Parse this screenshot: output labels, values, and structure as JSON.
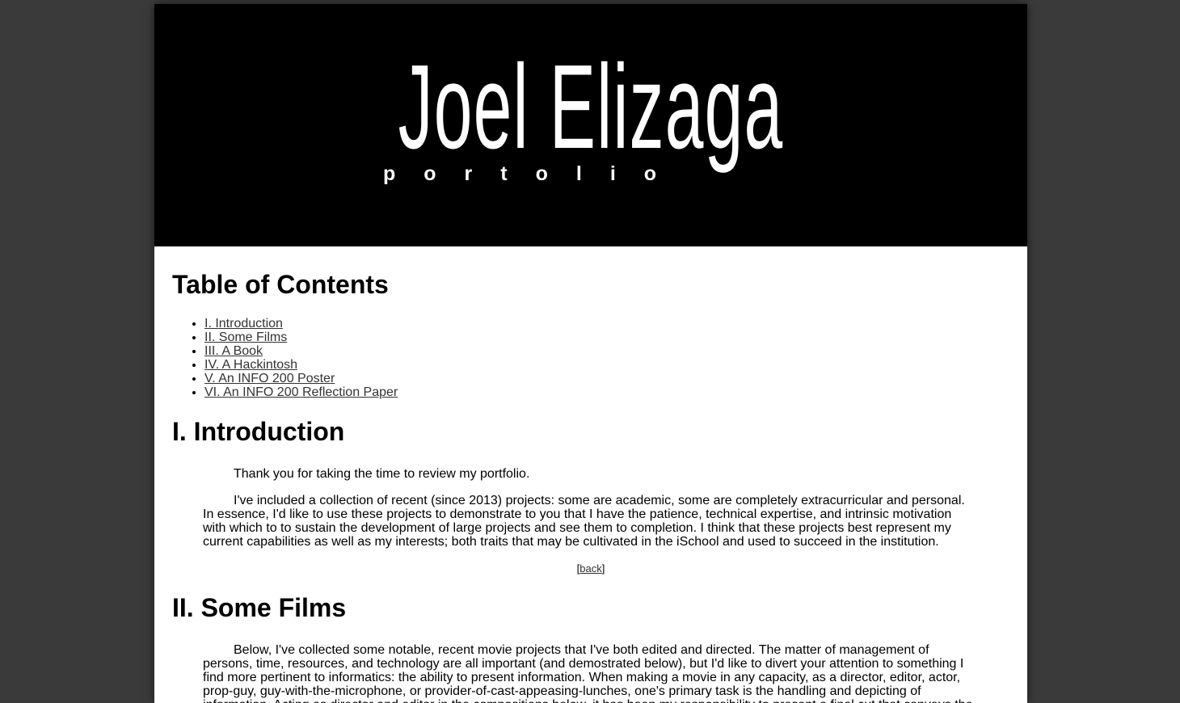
{
  "header": {
    "name": "Joel Elizaga",
    "subtitle": "portolio"
  },
  "toc": {
    "title": "Table of Contents",
    "items": [
      {
        "label": "I. Introduction"
      },
      {
        "label": "II. Some Films"
      },
      {
        "label": "III. A Book"
      },
      {
        "label": "IV. A Hackintosh"
      },
      {
        "label": "V. An INFO 200 Poster"
      },
      {
        "label": "VI. An INFO 200 Reflection Paper"
      }
    ]
  },
  "intro": {
    "title": "I. Introduction",
    "paragraph1": "Thank you for taking the time to review my portfolio.",
    "paragraph2": "I've included a collection of recent (since 2013) projects: some are academic, some are completely extracurricular and personal. In essence, I'd like to use these projects to demonstrate to you that I have the patience, technical expertise, and intrinsic motivation with which to to sustain the development of large projects and see them to completion. I think that these projects best represent my current capabilities as well as my interests; both traits that may be cultivated in the iSchool and used to succeed in the institution.",
    "back_open": "[",
    "back_label": "back",
    "back_close": "]"
  },
  "films": {
    "title": "II. Some Films",
    "paragraph1": "Below, I've collected some notable, recent movie projects that I've both edited and directed. The matter of management of persons, time, resources, and technology are all important (and demostrated below), but I'd like to divert your attention to something I find more pertinent to informatics: the ability to present information. When making a movie in any capacity, as a director, editor, actor, prop-guy, guy-with-the-microphone, or provider-of-cast-appeasing-lunches, one's primary task is the handling and depicting of information. Acting as director and editor in the compositions below, it has been my responsibility to present a final cut that conveys the story and message"
  }
}
